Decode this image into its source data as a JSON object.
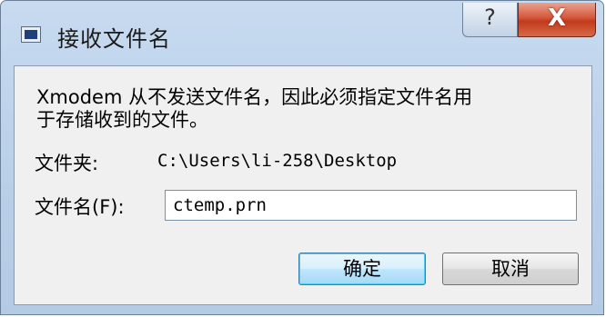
{
  "window": {
    "title": "接收文件名",
    "help_glyph": "?",
    "close_glyph": "X"
  },
  "message": {
    "line1": "Xmodem 从不发送文件名，因此必须指定文件名用",
    "line2": "于存储收到的文件。"
  },
  "folder": {
    "label": "文件夹:",
    "value": "C:\\Users\\li-258\\Desktop"
  },
  "filename": {
    "label": "文件名(F):",
    "value": "ctemp.prn"
  },
  "buttons": {
    "ok": "确定",
    "cancel": "取消"
  }
}
